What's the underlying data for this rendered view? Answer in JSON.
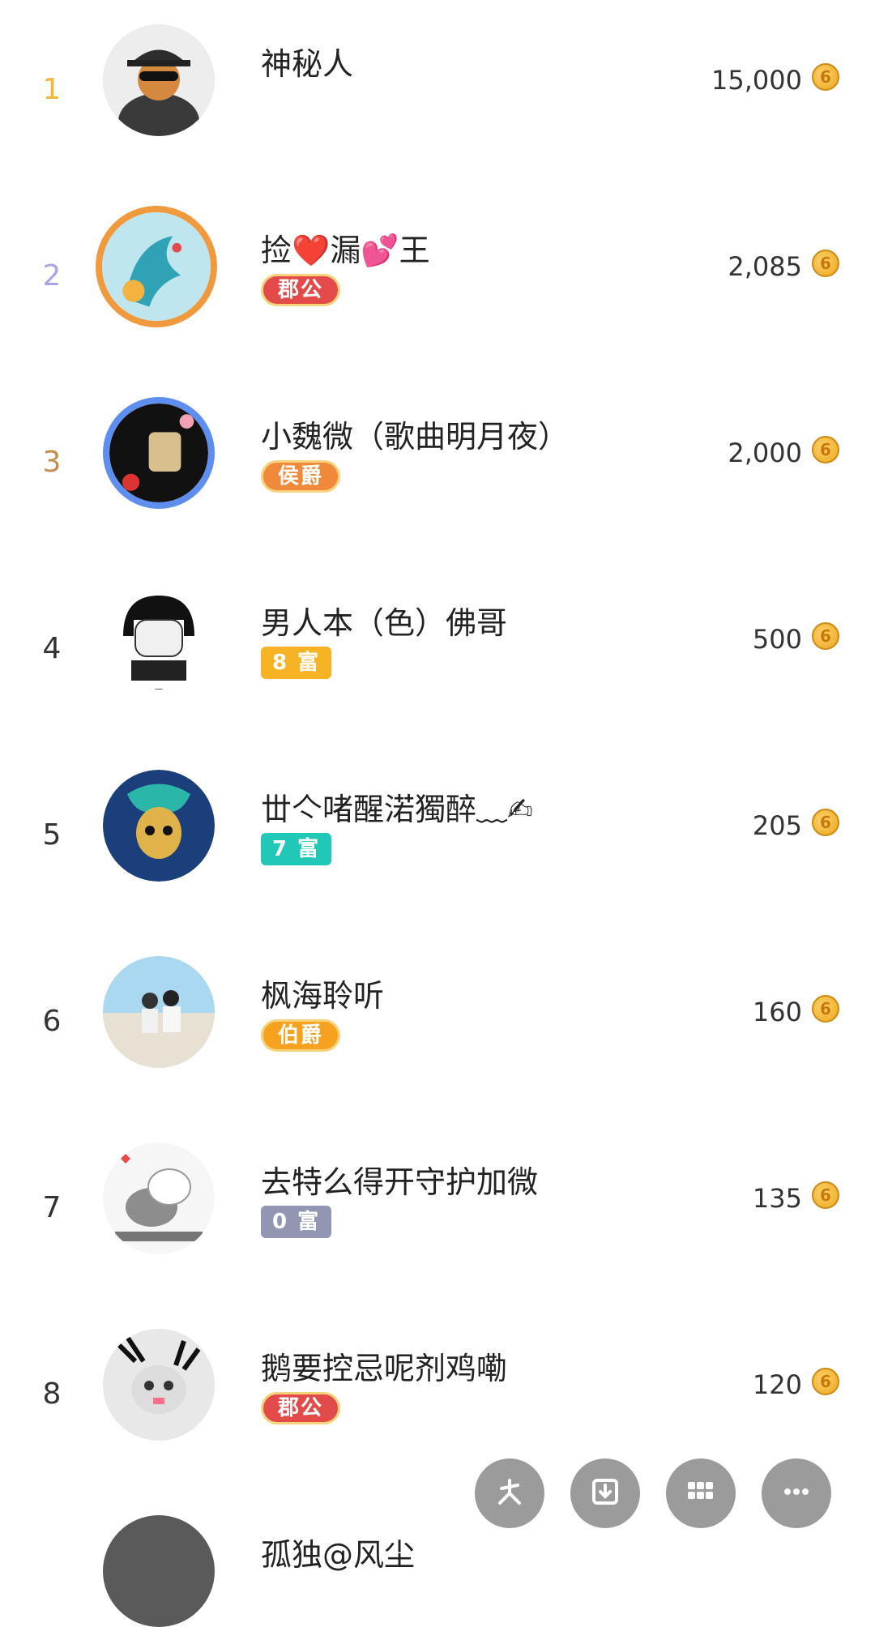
{
  "ranking": [
    {
      "rank": "1",
      "name": "神秘人",
      "badge": "",
      "score": "15,000",
      "rank_color": "#f2b63b",
      "avatar_icon": "spy-avatar"
    },
    {
      "rank": "2",
      "name": "捡❤️漏💕王",
      "badge": "郡公",
      "score": "2,085",
      "rank_color": "#a9a4e6",
      "avatar_icon": "dragon-avatar",
      "badge_color": "#e34b4b"
    },
    {
      "rank": "3",
      "name": "小魏微（歌曲明月夜）",
      "badge": "侯爵",
      "score": "2,000",
      "rank_color": "#c88b4b",
      "avatar_icon": "girl-avatar",
      "badge_color": "#f08a3a"
    },
    {
      "rank": "4",
      "name": "男人本（色）佛哥",
      "badge": "8 富",
      "score": "500",
      "rank_color": "#333333",
      "avatar_icon": "meme-avatar",
      "badge_color": "#f6b325"
    },
    {
      "rank": "5",
      "name": "丗亽啫醒渃獨醉﹏✍",
      "badge": "7 富",
      "score": "205",
      "rank_color": "#333333",
      "avatar_icon": "skull-avatar",
      "badge_color": "#21c7b7"
    },
    {
      "rank": "6",
      "name": "枫海聆听",
      "badge": "伯爵",
      "score": "160",
      "rank_color": "#333333",
      "avatar_icon": "couple-avatar",
      "badge_color": "#f6a21f"
    },
    {
      "rank": "7",
      "name": "去特么得开守护加微",
      "badge": "0 富",
      "score": "135",
      "rank_color": "#333333",
      "avatar_icon": "cat-avatar",
      "badge_color": "#9296b3"
    },
    {
      "rank": "8",
      "name": "鹅要控忌呢剂鸡嘞",
      "badge": "郡公",
      "score": "120",
      "rank_color": "#333333",
      "avatar_icon": "kitten-avatar",
      "badge_color": "#e34b4b"
    }
  ],
  "partial_row": {
    "name": "孤独@风尘"
  },
  "coin_glyph": "6",
  "fab": {
    "icons": [
      "share-icon",
      "download-icon",
      "grid-icon",
      "more-icon"
    ]
  }
}
